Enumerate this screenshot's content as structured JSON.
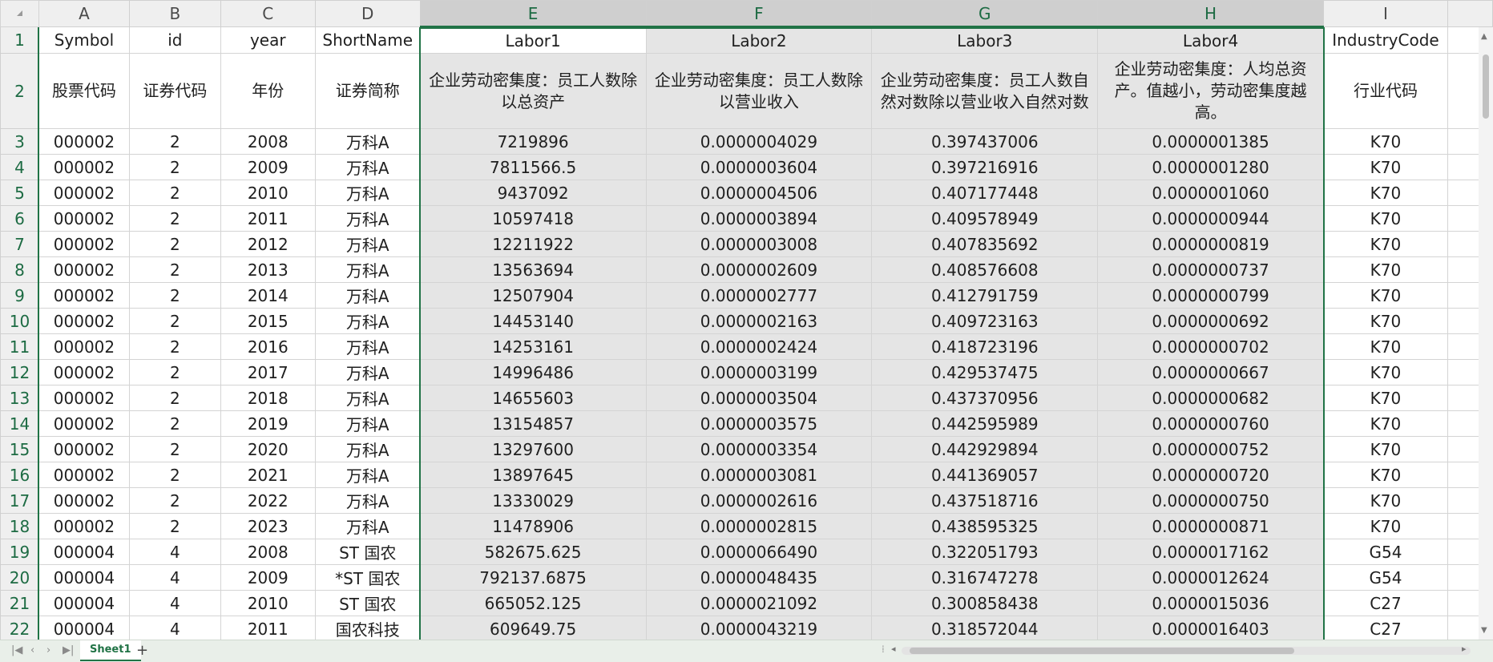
{
  "columns": [
    "A",
    "B",
    "C",
    "D",
    "E",
    "F",
    "G",
    "H",
    "I"
  ],
  "selected_columns": [
    "E",
    "F",
    "G",
    "H"
  ],
  "header_row": {
    "row": "1",
    "cells": [
      "Symbol",
      "id",
      "year",
      "ShortName",
      "Labor1",
      "Labor2",
      "Labor3",
      "Labor4",
      "IndustryCode"
    ]
  },
  "desc_row": {
    "row": "2",
    "cells": [
      "股票代码",
      "证券代码",
      "年份",
      "证券简称",
      "企业劳动密集度：员工人数除以总资产",
      "企业劳动密集度：员工人数除以营业收入",
      "企业劳动密集度：员工人数自然对数除以营业收入自然对数",
      "企业劳动密集度：人均总资产。值越小，劳动密集度越高。",
      "行业代码"
    ]
  },
  "rows": [
    {
      "row": "3",
      "cells": [
        "000002",
        "2",
        "2008",
        "万科A",
        "7219896",
        "0.0000004029",
        "0.397437006",
        "0.0000001385",
        "K70"
      ]
    },
    {
      "row": "4",
      "cells": [
        "000002",
        "2",
        "2009",
        "万科A",
        "7811566.5",
        "0.0000003604",
        "0.397216916",
        "0.0000001280",
        "K70"
      ]
    },
    {
      "row": "5",
      "cells": [
        "000002",
        "2",
        "2010",
        "万科A",
        "9437092",
        "0.0000004506",
        "0.407177448",
        "0.0000001060",
        "K70"
      ]
    },
    {
      "row": "6",
      "cells": [
        "000002",
        "2",
        "2011",
        "万科A",
        "10597418",
        "0.0000003894",
        "0.409578949",
        "0.0000000944",
        "K70"
      ]
    },
    {
      "row": "7",
      "cells": [
        "000002",
        "2",
        "2012",
        "万科A",
        "12211922",
        "0.0000003008",
        "0.407835692",
        "0.0000000819",
        "K70"
      ]
    },
    {
      "row": "8",
      "cells": [
        "000002",
        "2",
        "2013",
        "万科A",
        "13563694",
        "0.0000002609",
        "0.408576608",
        "0.0000000737",
        "K70"
      ]
    },
    {
      "row": "9",
      "cells": [
        "000002",
        "2",
        "2014",
        "万科A",
        "12507904",
        "0.0000002777",
        "0.412791759",
        "0.0000000799",
        "K70"
      ]
    },
    {
      "row": "10",
      "cells": [
        "000002",
        "2",
        "2015",
        "万科A",
        "14453140",
        "0.0000002163",
        "0.409723163",
        "0.0000000692",
        "K70"
      ]
    },
    {
      "row": "11",
      "cells": [
        "000002",
        "2",
        "2016",
        "万科A",
        "14253161",
        "0.0000002424",
        "0.418723196",
        "0.0000000702",
        "K70"
      ]
    },
    {
      "row": "12",
      "cells": [
        "000002",
        "2",
        "2017",
        "万科A",
        "14996486",
        "0.0000003199",
        "0.429537475",
        "0.0000000667",
        "K70"
      ]
    },
    {
      "row": "13",
      "cells": [
        "000002",
        "2",
        "2018",
        "万科A",
        "14655603",
        "0.0000003504",
        "0.437370956",
        "0.0000000682",
        "K70"
      ]
    },
    {
      "row": "14",
      "cells": [
        "000002",
        "2",
        "2019",
        "万科A",
        "13154857",
        "0.0000003575",
        "0.442595989",
        "0.0000000760",
        "K70"
      ]
    },
    {
      "row": "15",
      "cells": [
        "000002",
        "2",
        "2020",
        "万科A",
        "13297600",
        "0.0000003354",
        "0.442929894",
        "0.0000000752",
        "K70"
      ]
    },
    {
      "row": "16",
      "cells": [
        "000002",
        "2",
        "2021",
        "万科A",
        "13897645",
        "0.0000003081",
        "0.441369057",
        "0.0000000720",
        "K70"
      ]
    },
    {
      "row": "17",
      "cells": [
        "000002",
        "2",
        "2022",
        "万科A",
        "13330029",
        "0.0000002616",
        "0.437518716",
        "0.0000000750",
        "K70"
      ]
    },
    {
      "row": "18",
      "cells": [
        "000002",
        "2",
        "2023",
        "万科A",
        "11478906",
        "0.0000002815",
        "0.438595325",
        "0.0000000871",
        "K70"
      ]
    },
    {
      "row": "19",
      "cells": [
        "000004",
        "4",
        "2008",
        "ST 国农",
        "582675.625",
        "0.0000066490",
        "0.322051793",
        "0.0000017162",
        "G54"
      ]
    },
    {
      "row": "20",
      "cells": [
        "000004",
        "4",
        "2009",
        "*ST 国农",
        "792137.6875",
        "0.0000048435",
        "0.316747278",
        "0.0000012624",
        "G54"
      ]
    },
    {
      "row": "21",
      "cells": [
        "000004",
        "4",
        "2010",
        "ST 国农",
        "665052.125",
        "0.0000021092",
        "0.300858438",
        "0.0000015036",
        "C27"
      ]
    },
    {
      "row": "22",
      "cells": [
        "000004",
        "4",
        "2011",
        "国农科技",
        "609649.75",
        "0.0000043219",
        "0.318572044",
        "0.0000016403",
        "C27"
      ]
    }
  ],
  "sheet_tabs": {
    "active": "Sheet1",
    "add_label": "+"
  },
  "nav_icons": [
    "first-sheet-icon",
    "prev-sheet-icon",
    "next-sheet-icon",
    "last-sheet-icon"
  ],
  "accent_color": "#217346"
}
